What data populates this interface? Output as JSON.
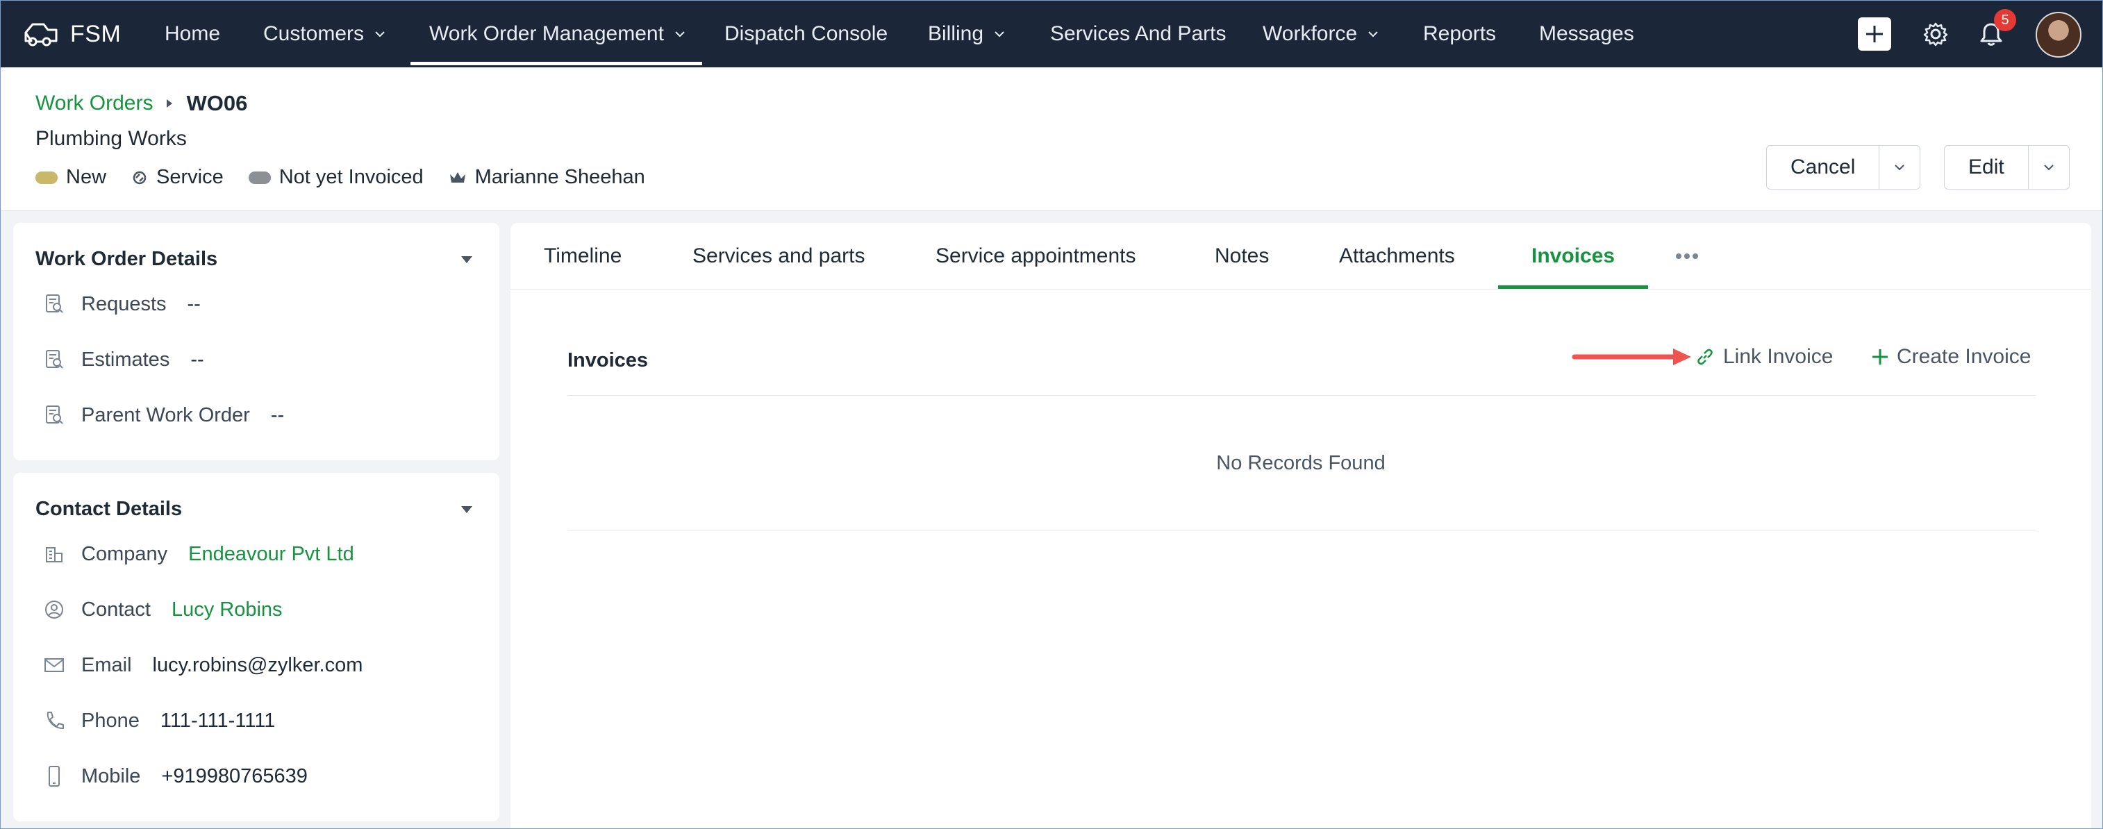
{
  "nav": {
    "brand": "FSM",
    "items": [
      {
        "label": "Home",
        "dropdown": false
      },
      {
        "label": "Customers",
        "dropdown": true
      },
      {
        "label": "Work Order Management",
        "dropdown": true,
        "active": true
      },
      {
        "label": "Dispatch Console",
        "dropdown": false
      },
      {
        "label": "Billing",
        "dropdown": true
      },
      {
        "label": "Services And Parts",
        "dropdown": false
      },
      {
        "label": "Workforce",
        "dropdown": true
      },
      {
        "label": "Reports",
        "dropdown": false
      },
      {
        "label": "Messages",
        "dropdown": false
      }
    ],
    "notification_count": "5"
  },
  "header": {
    "breadcrumb_parent": "Work Orders",
    "breadcrumb_current": "WO06",
    "subtitle": "Plumbing Works",
    "tags": [
      {
        "label": "New",
        "color": "#c9b86a"
      },
      {
        "label": "Service",
        "icon": "service-icon"
      },
      {
        "label": "Not yet Invoiced",
        "color": "#8c8f93"
      },
      {
        "label": "Marianne Sheehan",
        "icon": "crown-icon"
      }
    ],
    "cancel_label": "Cancel",
    "edit_label": "Edit"
  },
  "work_order_details": {
    "title": "Work Order Details",
    "rows": [
      {
        "label": "Requests",
        "value": "--"
      },
      {
        "label": "Estimates",
        "value": "--"
      },
      {
        "label": "Parent Work Order",
        "value": "--"
      }
    ]
  },
  "contact_details": {
    "title": "Contact Details",
    "rows": [
      {
        "label": "Company",
        "value": "Endeavour Pvt Ltd",
        "link": true,
        "icon": "building-icon"
      },
      {
        "label": "Contact",
        "value": "Lucy Robins",
        "link": true,
        "icon": "contact-icon"
      },
      {
        "label": "Email",
        "value": "lucy.robins@zylker.com",
        "link": false,
        "icon": "mail-icon"
      },
      {
        "label": "Phone",
        "value": "111-111-1111",
        "link": false,
        "icon": "phone-icon"
      },
      {
        "label": "Mobile",
        "value": "+919980765639",
        "link": false,
        "icon": "mobile-icon"
      }
    ]
  },
  "tabs": [
    {
      "label": "Timeline"
    },
    {
      "label": "Services and parts"
    },
    {
      "label": "Service appointments"
    },
    {
      "label": "Notes"
    },
    {
      "label": "Attachments"
    },
    {
      "label": "Invoices",
      "active": true
    }
  ],
  "invoices": {
    "section_title": "Invoices",
    "link_label": "Link Invoice",
    "create_label": "Create Invoice",
    "empty_text": "No Records Found"
  },
  "colors": {
    "nav_bg": "#1b2738",
    "accent_green": "#15933f",
    "annotation_arrow": "#ef5350"
  }
}
